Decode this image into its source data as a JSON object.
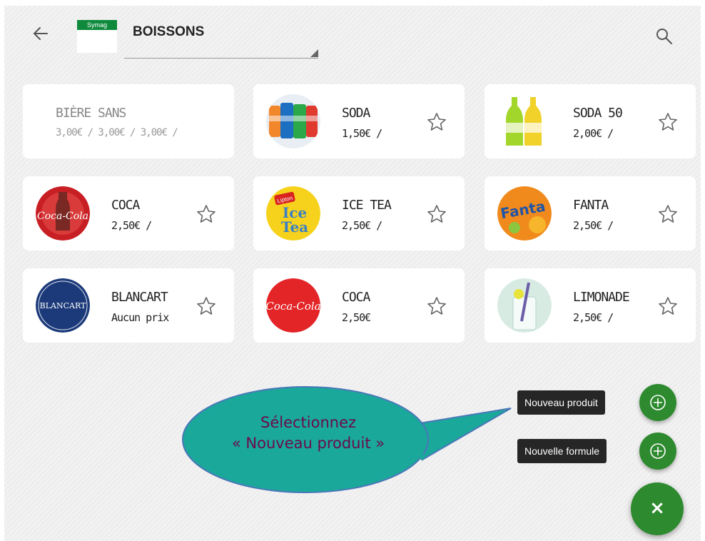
{
  "header": {
    "logo_text": "Symag",
    "category": "BOISSONS"
  },
  "products": [
    {
      "name": "BIÈRE SANS",
      "price": "3,00€ / 3,00€ / 3,00€ /",
      "image": "none"
    },
    {
      "name": "SODA",
      "price": "1,50€ /",
      "image": "soda-cans"
    },
    {
      "name": "SODA 50",
      "price": "2,00€ /",
      "image": "soda-bottles"
    },
    {
      "name": "COCA",
      "price": "2,50€ /",
      "image": "coca-cola-bottle-logo"
    },
    {
      "name": "ICE TEA",
      "price": "2,50€ /",
      "image": "lipton-ice-tea-logo",
      "logo": [
        "Lipton",
        "Ice",
        "Tea"
      ]
    },
    {
      "name": "FANTA",
      "price": "2,50€ /",
      "image": "fanta-logo",
      "logo": [
        "Fanta"
      ]
    },
    {
      "name": "BLANCART",
      "price": "Aucun prix",
      "image": "blancart-logo",
      "logo": [
        "BLANCART"
      ]
    },
    {
      "name": "COCA",
      "price": "2,50€",
      "image": "coca-cola-logo",
      "logo": [
        "Coca-Cola"
      ]
    },
    {
      "name": "LIMONADE",
      "price": "2,50€ /",
      "image": "lemonade-glass"
    }
  ],
  "fab_menu": {
    "new_product": "Nouveau produit",
    "new_formula": "Nouvelle formule",
    "close_glyph": "×"
  },
  "callout": {
    "line1": "Sélectionnez",
    "line2": "« Nouveau produit »"
  },
  "colors": {
    "fab_green": "#2e8a2f",
    "callout_fill": "#1aa89a",
    "callout_text": "#6a0b4c",
    "tooltip_bg": "#262626"
  }
}
